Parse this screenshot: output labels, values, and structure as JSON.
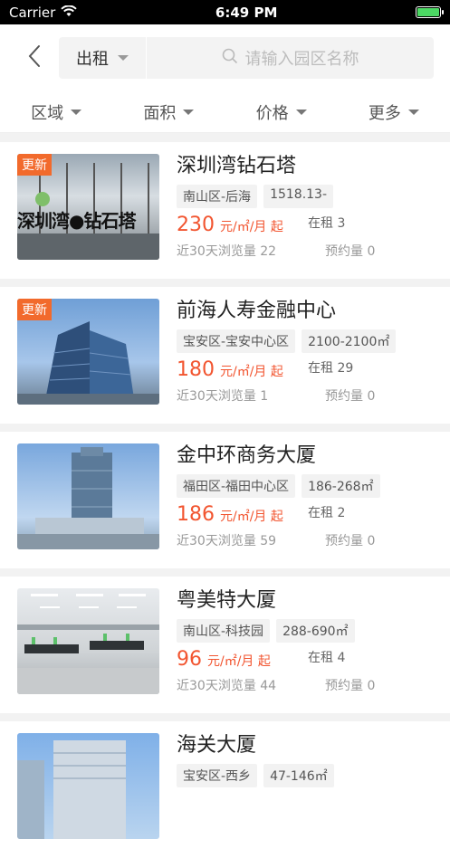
{
  "status": {
    "carrier": "Carrier",
    "time": "6:49 PM"
  },
  "nav": {
    "type_label": "出租",
    "search_placeholder": "请输入园区名称"
  },
  "filters": [
    {
      "label": "区域"
    },
    {
      "label": "面积"
    },
    {
      "label": "价格"
    },
    {
      "label": "更多"
    }
  ],
  "listings": [
    {
      "title": "深圳湾钻石塔",
      "badge": "更新",
      "tags": [
        "南山区-后海",
        "1518.13-"
      ],
      "price": "230",
      "unit": "元/㎡/月 起",
      "rent": "在租 3",
      "views": "近30天浏览量 22",
      "booking": "预约量 0",
      "img_text": "深圳湾●钻石塔"
    },
    {
      "title": "前海人寿金融中心",
      "badge": "更新",
      "tags": [
        "宝安区-宝安中心区",
        "2100-2100㎡"
      ],
      "price": "180",
      "unit": "元/㎡/月 起",
      "rent": "在租 29",
      "views": "近30天浏览量 1",
      "booking": "预约量 0"
    },
    {
      "title": "金中环商务大厦",
      "badge": "",
      "tags": [
        "福田区-福田中心区",
        "186-268㎡"
      ],
      "price": "186",
      "unit": "元/㎡/月 起",
      "rent": "在租 2",
      "views": "近30天浏览量 59",
      "booking": "预约量 0"
    },
    {
      "title": "粤美特大厦",
      "badge": "",
      "tags": [
        "南山区-科技园",
        "288-690㎡"
      ],
      "price": "96",
      "unit": "元/㎡/月 起",
      "rent": "在租 4",
      "views": "近30天浏览量 44",
      "booking": "预约量 0"
    },
    {
      "title": "海关大厦",
      "badge": "",
      "tags": [
        "宝安区-西乡",
        "47-146㎡"
      ]
    }
  ]
}
